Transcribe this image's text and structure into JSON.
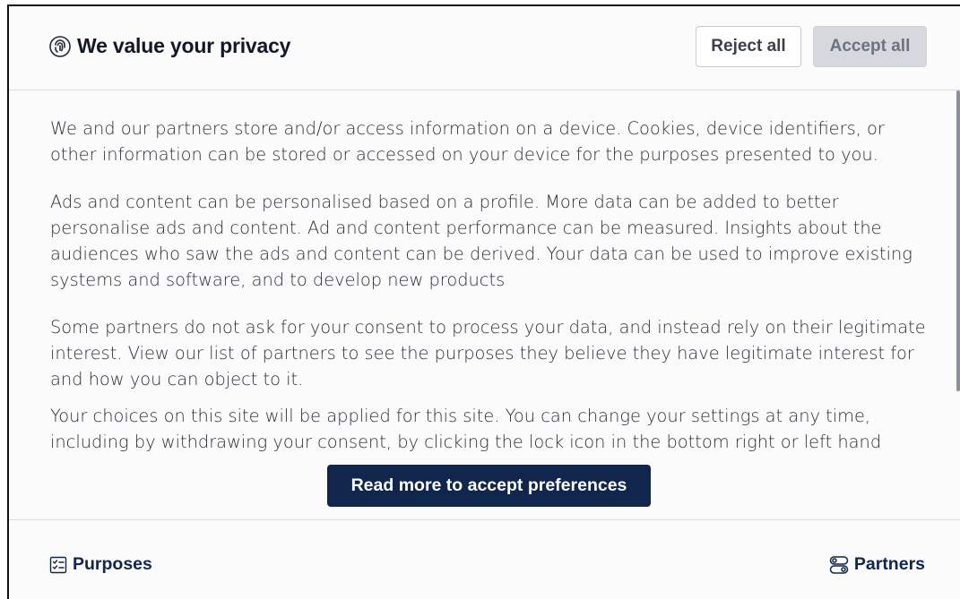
{
  "header": {
    "title": "We value your privacy",
    "icon": "fingerprint-icon",
    "reject_label": "Reject all",
    "accept_label": "Accept all"
  },
  "body": {
    "paragraphs": [
      "We and our partners store and/or access information on a device. Cookies, device identifiers, or other information can be stored or accessed on your device for the purposes presented to you.",
      "Ads and content can be personalised based on a profile. More data can be added to better personalise ads and content. Ad and content performance can be measured. Insights about the audiences who saw the ads and content can be derived. Your data can be used to improve existing systems and software, and to develop new products",
      "Some partners do not ask for your consent to process your data, and instead rely on their legitimate interest. View our list of partners to see the purposes they believe they have legitimate interest for and how you can object to it.",
      "Your choices on this site will be applied for this site. You can change your settings at any time, including by withdrawing your consent, by clicking the lock icon in the bottom right or left hand"
    ]
  },
  "read_more_label": "Read more to accept preferences",
  "footer": {
    "purposes_label": "Purposes",
    "purposes_icon": "checklist-icon",
    "partners_label": "Partners",
    "partners_icon": "toggles-icon"
  },
  "colors": {
    "primary": "#10264d",
    "accept_bg": "#d6d8de",
    "border": "#dcdde3"
  }
}
